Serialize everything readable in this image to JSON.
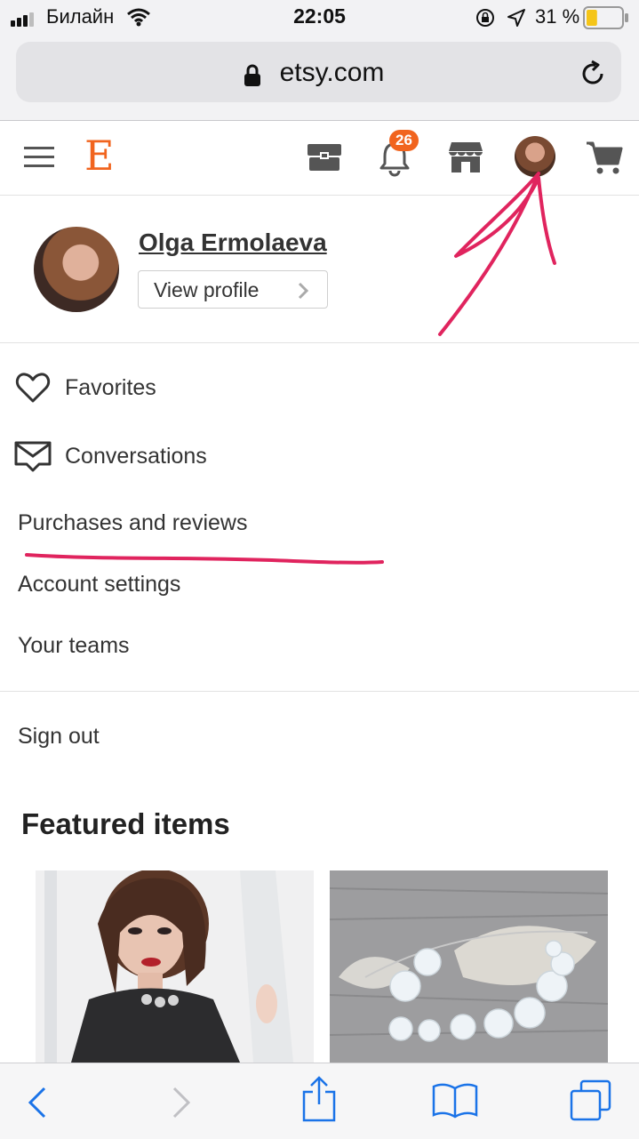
{
  "status_bar": {
    "carrier": "Билайн",
    "time": "22:05",
    "battery_percent": "31 %",
    "battery_level": 0.31
  },
  "browser": {
    "url": "etsy.com"
  },
  "header": {
    "logo_text": "E",
    "notification_count": "26"
  },
  "profile": {
    "name": "Olga Ermolaeva",
    "view_profile_label": "View profile"
  },
  "menu": {
    "favorites": "Favorites",
    "conversations": "Conversations",
    "purchases": "Purchases and reviews",
    "account_settings": "Account settings",
    "your_teams": "Your teams",
    "sign_out": "Sign out"
  },
  "featured": {
    "title": "Featured items"
  },
  "colors": {
    "brand": "#f1641e",
    "annotation": "#e0245e"
  },
  "icons": [
    "menu-icon",
    "gift-box-icon",
    "bell-icon",
    "shop-icon",
    "avatar",
    "cart-icon",
    "heart-icon",
    "envelope-icon",
    "lock-icon",
    "reload-icon",
    "back-icon",
    "forward-icon",
    "share-icon",
    "bookmarks-icon",
    "tabs-icon"
  ]
}
